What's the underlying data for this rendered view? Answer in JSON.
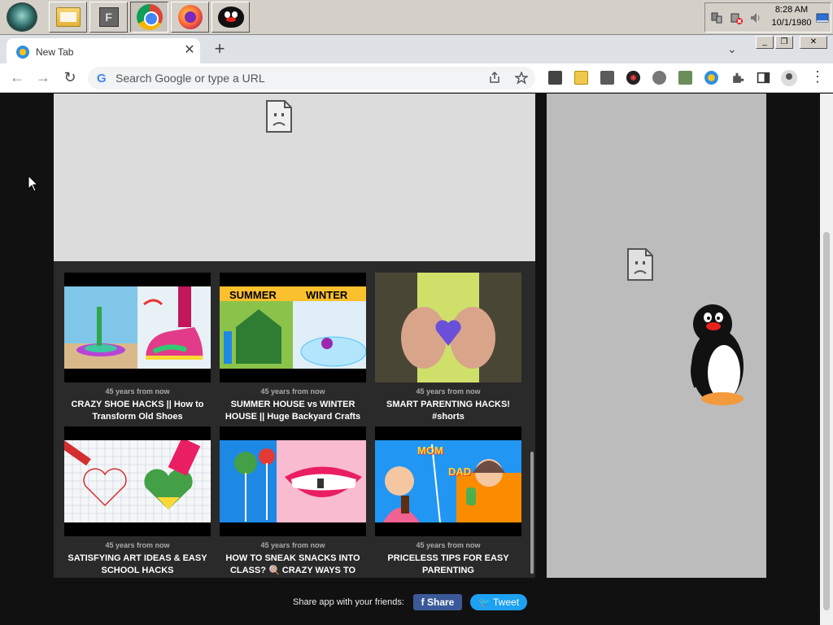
{
  "taskbar": {
    "apps": [
      {
        "name": "file-explorer"
      },
      {
        "name": "f-app",
        "glyph": "F"
      },
      {
        "name": "chrome"
      },
      {
        "name": "firefox"
      },
      {
        "name": "pingu"
      }
    ],
    "clock": {
      "time": "8:28 AM",
      "date": "10/1/1980"
    }
  },
  "browser": {
    "tab": {
      "title": "New Tab",
      "close": "✕"
    },
    "new_tab": "+",
    "tab_search": "⌄",
    "window_buttons": {
      "minimize": "_",
      "restore": "❐",
      "close": "✕"
    },
    "omnibox": {
      "placeholder": "Search Google or type a URL",
      "google_glyph": "G"
    },
    "nav": {
      "back": "←",
      "forward": "→",
      "reload": "↻"
    },
    "menu": "⋮"
  },
  "content": {
    "videos": [
      {
        "time": "45 years from now",
        "title": "CRAZY SHOE HACKS || How to Transform Old Shoes"
      },
      {
        "time": "45 years from now",
        "title": "SUMMER HOUSE vs WINTER HOUSE || Huge Backyard Crafts",
        "labels": [
          "SUMMER",
          "WINTER"
        ]
      },
      {
        "time": "45 years from now",
        "title": "SMART PARENTING HACKS! #shorts"
      },
      {
        "time": "45 years from now",
        "title": "SATISFYING ART IDEAS & EASY SCHOOL HACKS"
      },
      {
        "time": "45 years from now",
        "title": "HOW TO SNEAK SNACKS INTO CLASS? 🍭 CRAZY WAYS TO"
      },
      {
        "time": "45 years from now",
        "title": "PRICELESS TIPS FOR EASY PARENTING",
        "labels": [
          "MOM",
          "DAD"
        ]
      }
    ],
    "share": {
      "text": "Share app with your friends:",
      "share_label": "f  Share",
      "tweet_label": "🐦 Tweet"
    }
  },
  "colors": {
    "facebook": "#3b5998",
    "twitter": "#1da1f2",
    "page_bg": "#111111",
    "ad_bg": "#dcdcdc"
  }
}
